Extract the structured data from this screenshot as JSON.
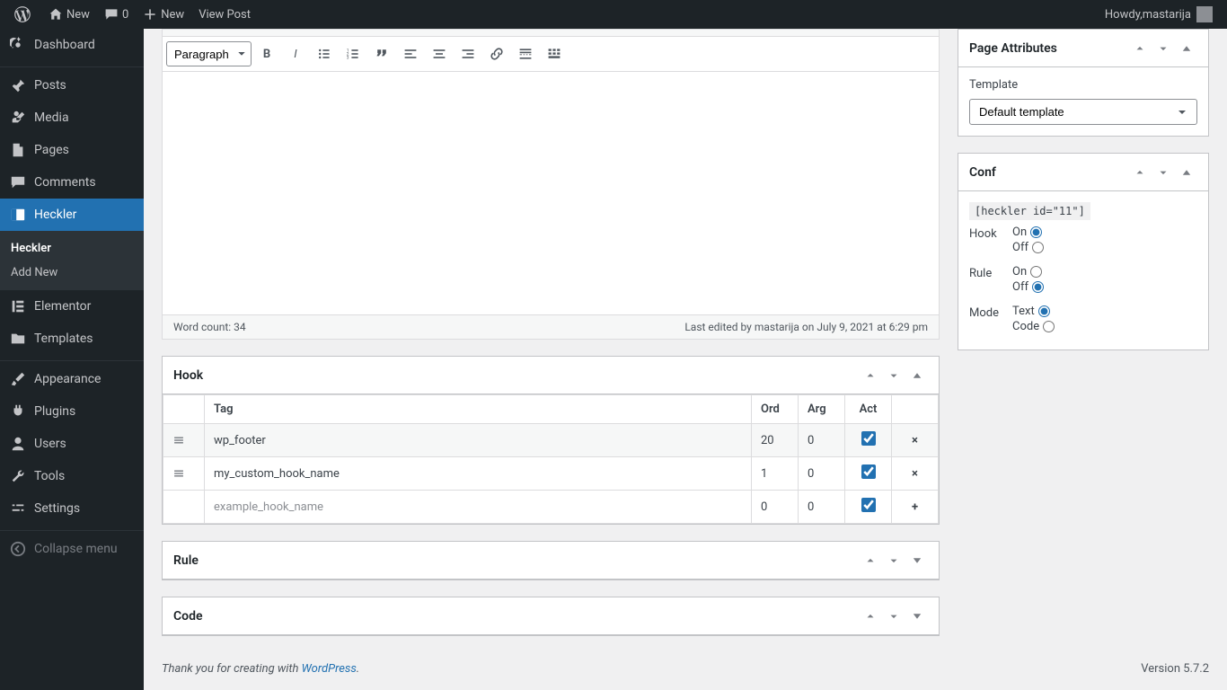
{
  "adminbar": {
    "home": "New",
    "comments_count": "0",
    "new": "New",
    "view_post": "View Post",
    "howdy_prefix": "Howdy, ",
    "username": "mastarija"
  },
  "menu": {
    "dashboard": "Dashboard",
    "posts": "Posts",
    "media": "Media",
    "pages": "Pages",
    "comments": "Comments",
    "heckler": "Heckler",
    "heckler_sub_all": "Heckler",
    "heckler_sub_add": "Add New",
    "elementor": "Elementor",
    "templates": "Templates",
    "appearance": "Appearance",
    "plugins": "Plugins",
    "users": "Users",
    "tools": "Tools",
    "settings": "Settings",
    "collapse": "Collapse menu"
  },
  "editor": {
    "format_selector": "Paragraph",
    "word_count_label": "Word count: 34",
    "last_edited": "Last edited by mastarija on July 9, 2021 at 6:29 pm"
  },
  "postboxes": {
    "hook_title": "Hook",
    "rule_title": "Rule",
    "code_title": "Code",
    "page_attributes_title": "Page Attributes",
    "template_label": "Template",
    "template_value": "Default template",
    "conf_title": "Conf"
  },
  "hook_table": {
    "headers": {
      "tag": "Tag",
      "ord": "Ord",
      "arg": "Arg",
      "act": "Act"
    },
    "rows": [
      {
        "tag": "wp_footer",
        "ord": "20",
        "arg": "0",
        "act": true,
        "row_action": "×",
        "highlight": true,
        "drag": true
      },
      {
        "tag": "my_custom_hook_name",
        "ord": "1",
        "arg": "0",
        "act": true,
        "row_action": "×",
        "highlight": false,
        "drag": true
      },
      {
        "tag": "example_hook_name",
        "placeholder": true,
        "ord": "0",
        "arg": "0",
        "act": true,
        "row_action": "+",
        "highlight": false,
        "drag": false
      }
    ]
  },
  "conf": {
    "shortcode": "[heckler id=\"11\"]",
    "hook_label": "Hook",
    "rule_label": "Rule",
    "mode_label": "Mode",
    "on": "On",
    "off": "Off",
    "text": "Text",
    "code": "Code",
    "hook_value": "on",
    "rule_value": "off",
    "mode_value": "text"
  },
  "footer": {
    "thankyou_prefix": "Thank you for creating with ",
    "wp_link": "WordPress",
    "version": "Version 5.7.2"
  }
}
